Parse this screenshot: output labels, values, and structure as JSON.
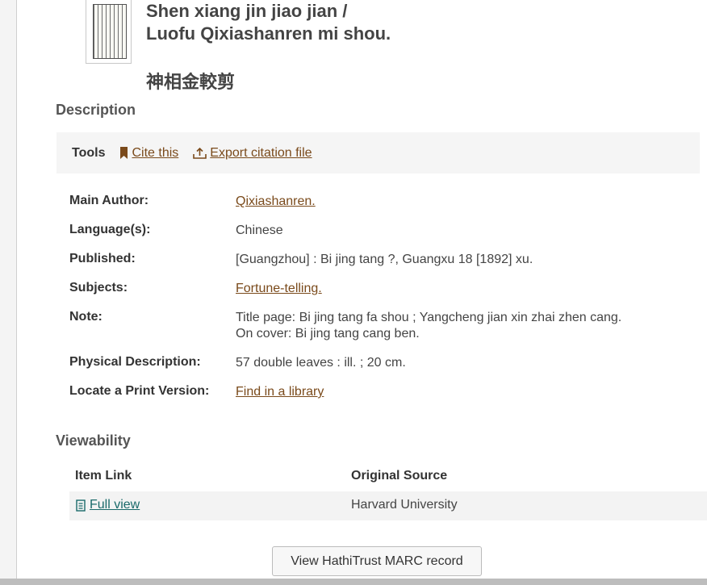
{
  "record": {
    "title_line1": "Shen xiang jin jiao jian /",
    "title_line2": "Luofu Qixiashanren mi shou.",
    "title_cjk": "神相金較剪"
  },
  "description": {
    "heading": "Description",
    "tools": {
      "label": "Tools",
      "cite_label": "Cite this",
      "export_label": "Export citation file"
    },
    "fields": {
      "main_author": {
        "label": "Main Author:",
        "value": "Qixiashanren."
      },
      "language": {
        "label": "Language(s):",
        "value": "Chinese"
      },
      "published": {
        "label": "Published:",
        "value": "[Guangzhou] : Bi jing tang ?, Guangxu 18 [1892] xu."
      },
      "subjects": {
        "label": "Subjects:",
        "value": "Fortune-telling."
      },
      "note": {
        "label": "Note:",
        "line1": "Title page: Bi jing tang fa shou ; Yangcheng jian xin zhai zhen cang.",
        "line2": "On cover: Bi jing tang cang ben."
      },
      "physical": {
        "label": "Physical Description:",
        "value": "57 double leaves : ill. ; 20 cm."
      },
      "locate": {
        "label": "Locate a Print Version:",
        "value": "Find in a library"
      }
    }
  },
  "viewability": {
    "heading": "Viewability",
    "columns": {
      "item_link": "Item Link",
      "original_source": "Original Source"
    },
    "rows": [
      {
        "link": "Full view",
        "source": "Harvard University"
      }
    ]
  },
  "actions": {
    "marc_button": "View HathiTrust MARC record"
  },
  "colors": {
    "link_brown": "#7a4a1b",
    "link_teal": "#1a6a6a",
    "tools_bg": "#f5f5f5"
  }
}
